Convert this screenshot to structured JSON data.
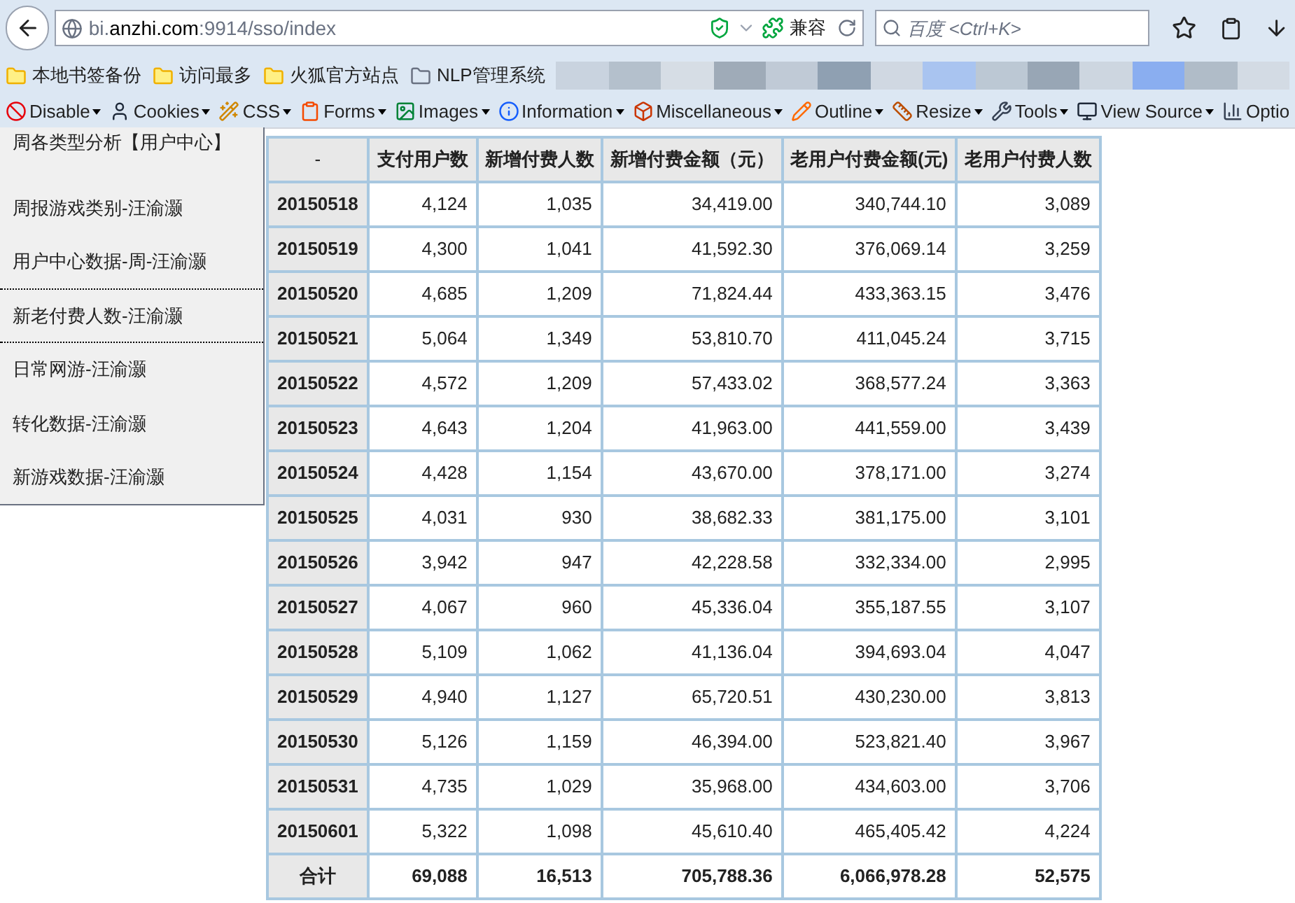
{
  "address_bar": {
    "host_prefix": "bi.",
    "host": "anzhi.com",
    "rest": ":9914/sso/index",
    "compat": "兼容"
  },
  "search": {
    "placeholder": "百度 <Ctrl+K>"
  },
  "bookmarks": [
    "本地书签备份",
    "访问最多",
    "火狐官方站点",
    "NLP管理系统"
  ],
  "toolbar": [
    "Disable",
    "Cookies",
    "CSS",
    "Forms",
    "Images",
    "Information",
    "Miscellaneous",
    "Outline",
    "Resize",
    "Tools",
    "View Source",
    "Optio"
  ],
  "sidebar": {
    "items": [
      {
        "label": "周各类型分析【用户中心】",
        "selected": false
      },
      {
        "label": "周报游戏类别-汪渝灏",
        "selected": false
      },
      {
        "label": "用户中心数据-周-汪渝灏",
        "selected": false
      },
      {
        "label": "新老付费人数-汪渝灏",
        "selected": true
      },
      {
        "label": "日常网游-汪渝灏",
        "selected": false
      },
      {
        "label": "转化数据-汪渝灏",
        "selected": false
      },
      {
        "label": "新游戏数据-汪渝灏",
        "selected": false
      }
    ]
  },
  "table": {
    "columns": [
      "-",
      "支付用户数",
      "新增付费人数",
      "新增付费金额（元）",
      "老用户付费金额(元)",
      "老用户付费人数"
    ],
    "rows": [
      [
        "20150518",
        "4,124",
        "1,035",
        "34,419.00",
        "340,744.10",
        "3,089"
      ],
      [
        "20150519",
        "4,300",
        "1,041",
        "41,592.30",
        "376,069.14",
        "3,259"
      ],
      [
        "20150520",
        "4,685",
        "1,209",
        "71,824.44",
        "433,363.15",
        "3,476"
      ],
      [
        "20150521",
        "5,064",
        "1,349",
        "53,810.70",
        "411,045.24",
        "3,715"
      ],
      [
        "20150522",
        "4,572",
        "1,209",
        "57,433.02",
        "368,577.24",
        "3,363"
      ],
      [
        "20150523",
        "4,643",
        "1,204",
        "41,963.00",
        "441,559.00",
        "3,439"
      ],
      [
        "20150524",
        "4,428",
        "1,154",
        "43,670.00",
        "378,171.00",
        "3,274"
      ],
      [
        "20150525",
        "4,031",
        "930",
        "38,682.33",
        "381,175.00",
        "3,101"
      ],
      [
        "20150526",
        "3,942",
        "947",
        "42,228.58",
        "332,334.00",
        "2,995"
      ],
      [
        "20150527",
        "4,067",
        "960",
        "45,336.04",
        "355,187.55",
        "3,107"
      ],
      [
        "20150528",
        "5,109",
        "1,062",
        "41,136.04",
        "394,693.04",
        "4,047"
      ],
      [
        "20150529",
        "4,940",
        "1,127",
        "65,720.51",
        "430,230.00",
        "3,813"
      ],
      [
        "20150530",
        "5,126",
        "1,159",
        "46,394.00",
        "523,821.40",
        "3,967"
      ],
      [
        "20150531",
        "4,735",
        "1,029",
        "35,968.00",
        "434,603.00",
        "3,706"
      ],
      [
        "20150601",
        "5,322",
        "1,098",
        "45,610.40",
        "465,405.42",
        "4,224"
      ]
    ],
    "total": [
      "合计",
      "69,088",
      "16,513",
      "705,788.36",
      "6,066,978.28",
      "52,575"
    ]
  }
}
